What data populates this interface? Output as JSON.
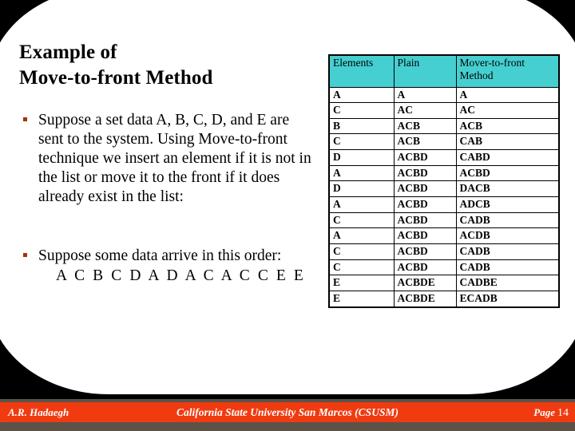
{
  "slide": {
    "title_lines": [
      "Example of",
      "Move-to-front Method"
    ],
    "bullets": [
      "Suppose a set data A, B, C, D, and E are sent to the system. Using Move-to-front technique we insert an element if it is not in the list or move it to the front if it does already exist in the list:",
      "Suppose some data arrive in this order:"
    ],
    "sequence": "A C B C D A D A C A C C E E"
  },
  "table": {
    "headers": [
      "Elements",
      "Plain",
      "Mover-to-front Method"
    ],
    "rows": [
      {
        "elements": "A",
        "plain": "A",
        "mtf": "A",
        "highlight": false
      },
      {
        "elements": "C",
        "plain": "AC",
        "mtf": "AC",
        "highlight": false
      },
      {
        "elements": "B",
        "plain": "ACB",
        "mtf": "ACB",
        "highlight": false
      },
      {
        "elements": "C",
        "plain": "ACB",
        "mtf": "CAB",
        "highlight": false
      },
      {
        "elements": "D",
        "plain": "ACBD",
        "mtf": "CABD",
        "highlight": false
      },
      {
        "elements": "A",
        "plain": "ACBD",
        "mtf": "ACBD",
        "highlight": false
      },
      {
        "elements": "D",
        "plain": "ACBD",
        "mtf": "DACB",
        "highlight": false
      },
      {
        "elements": "A",
        "plain": "ACBD",
        "mtf": "ADCB",
        "highlight": false
      },
      {
        "elements": "C",
        "plain": "ACBD",
        "mtf": "CADB",
        "highlight": false
      },
      {
        "elements": "A",
        "plain": "ACBD",
        "mtf": "ACDB",
        "highlight": false
      },
      {
        "elements": "C",
        "plain": "ACBD",
        "mtf": "CADB",
        "highlight": false
      },
      {
        "elements": "C",
        "plain": "ACBD",
        "mtf": "CADB",
        "highlight": false
      },
      {
        "elements": "E",
        "plain": "ACBDE",
        "mtf": "CADBE",
        "highlight": true
      },
      {
        "elements": "E",
        "plain": "ACBDE",
        "mtf": "ECADB",
        "highlight": true
      }
    ]
  },
  "footer": {
    "author": "A.R. Hadaegh",
    "center": "California State University San Marcos (CSUSM)",
    "page_label": "Page",
    "page_number": "14"
  },
  "colors": {
    "header_teal": "#45CFD0",
    "highlight_teal": "#2FC6C9",
    "footer_bar": "#F03B11",
    "footer_edge": "#5C5248",
    "bullet_dot": "#A63208",
    "background": "#000000",
    "plate": "#FFFFFF"
  }
}
